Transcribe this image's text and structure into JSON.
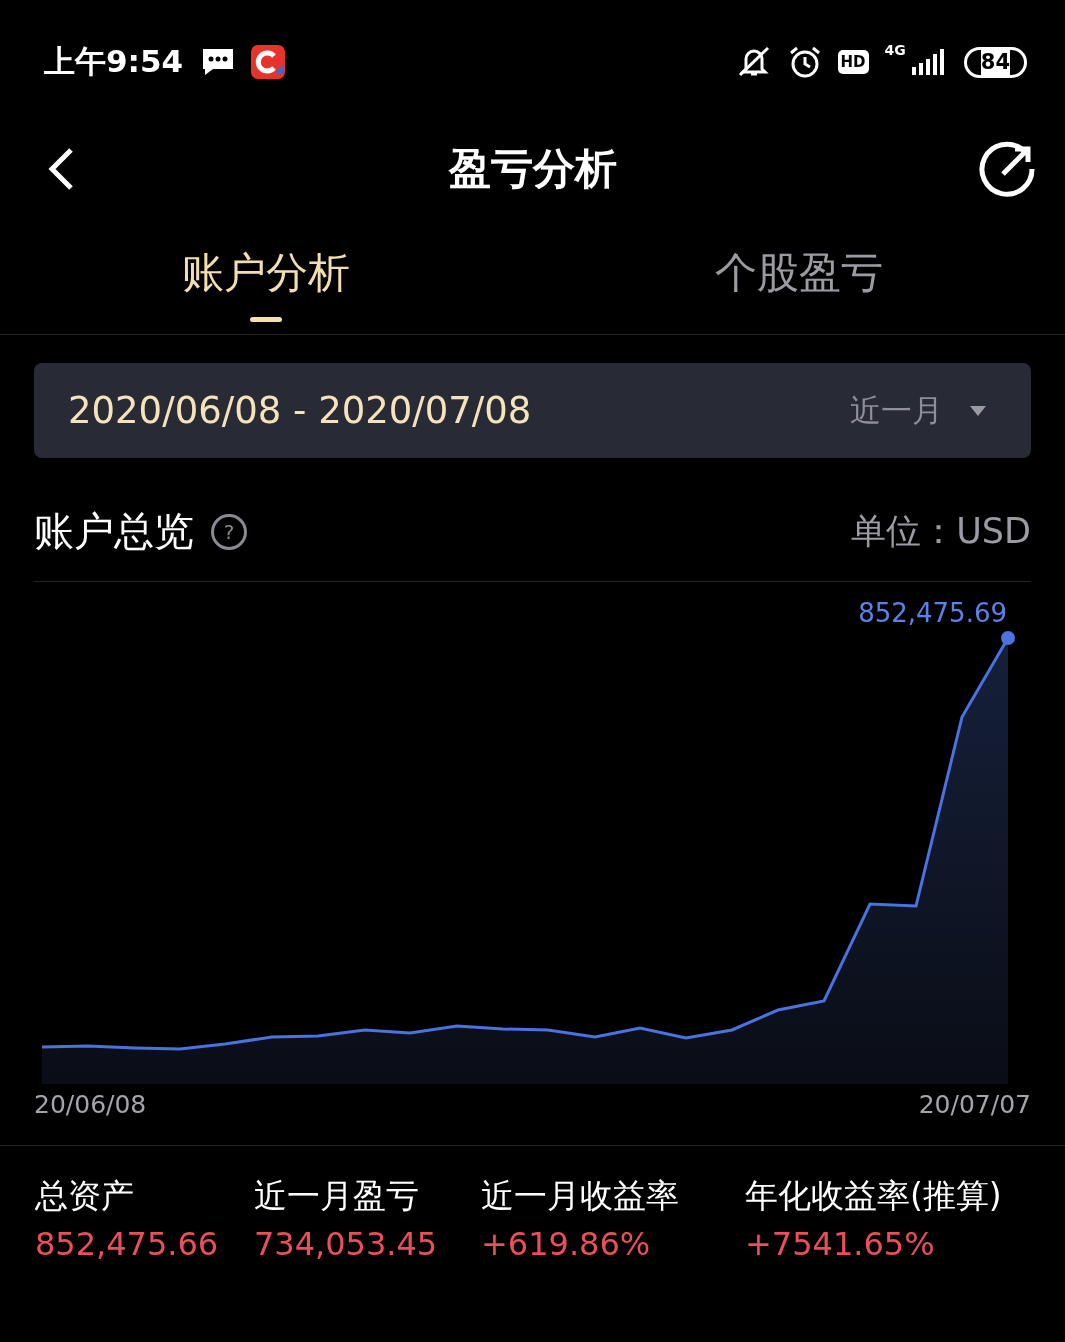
{
  "status_bar": {
    "time": "上午9:54",
    "network": "4G",
    "hd": "HD",
    "battery": "84"
  },
  "header": {
    "title": "盈亏分析"
  },
  "tabs": [
    {
      "label": "账户分析",
      "selected": true
    },
    {
      "label": "个股盈亏",
      "selected": false
    }
  ],
  "date_range": {
    "value": "2020/06/08 - 2020/07/08",
    "period": "近一月"
  },
  "overview": {
    "title": "账户总览",
    "help": "?",
    "unit": "单位：USD"
  },
  "chart": {
    "end_value": "852,475.69",
    "x_start": "20/06/08",
    "x_end": "20/07/07"
  },
  "stats": [
    {
      "label": "总资产",
      "value": "852,475.66"
    },
    {
      "label": "近一月盈亏",
      "value": "734,053.45"
    },
    {
      "label": "近一月收益率",
      "value": "+619.86%"
    },
    {
      "label": "年化收益率(推算)",
      "value": "+7541.65%"
    }
  ]
}
